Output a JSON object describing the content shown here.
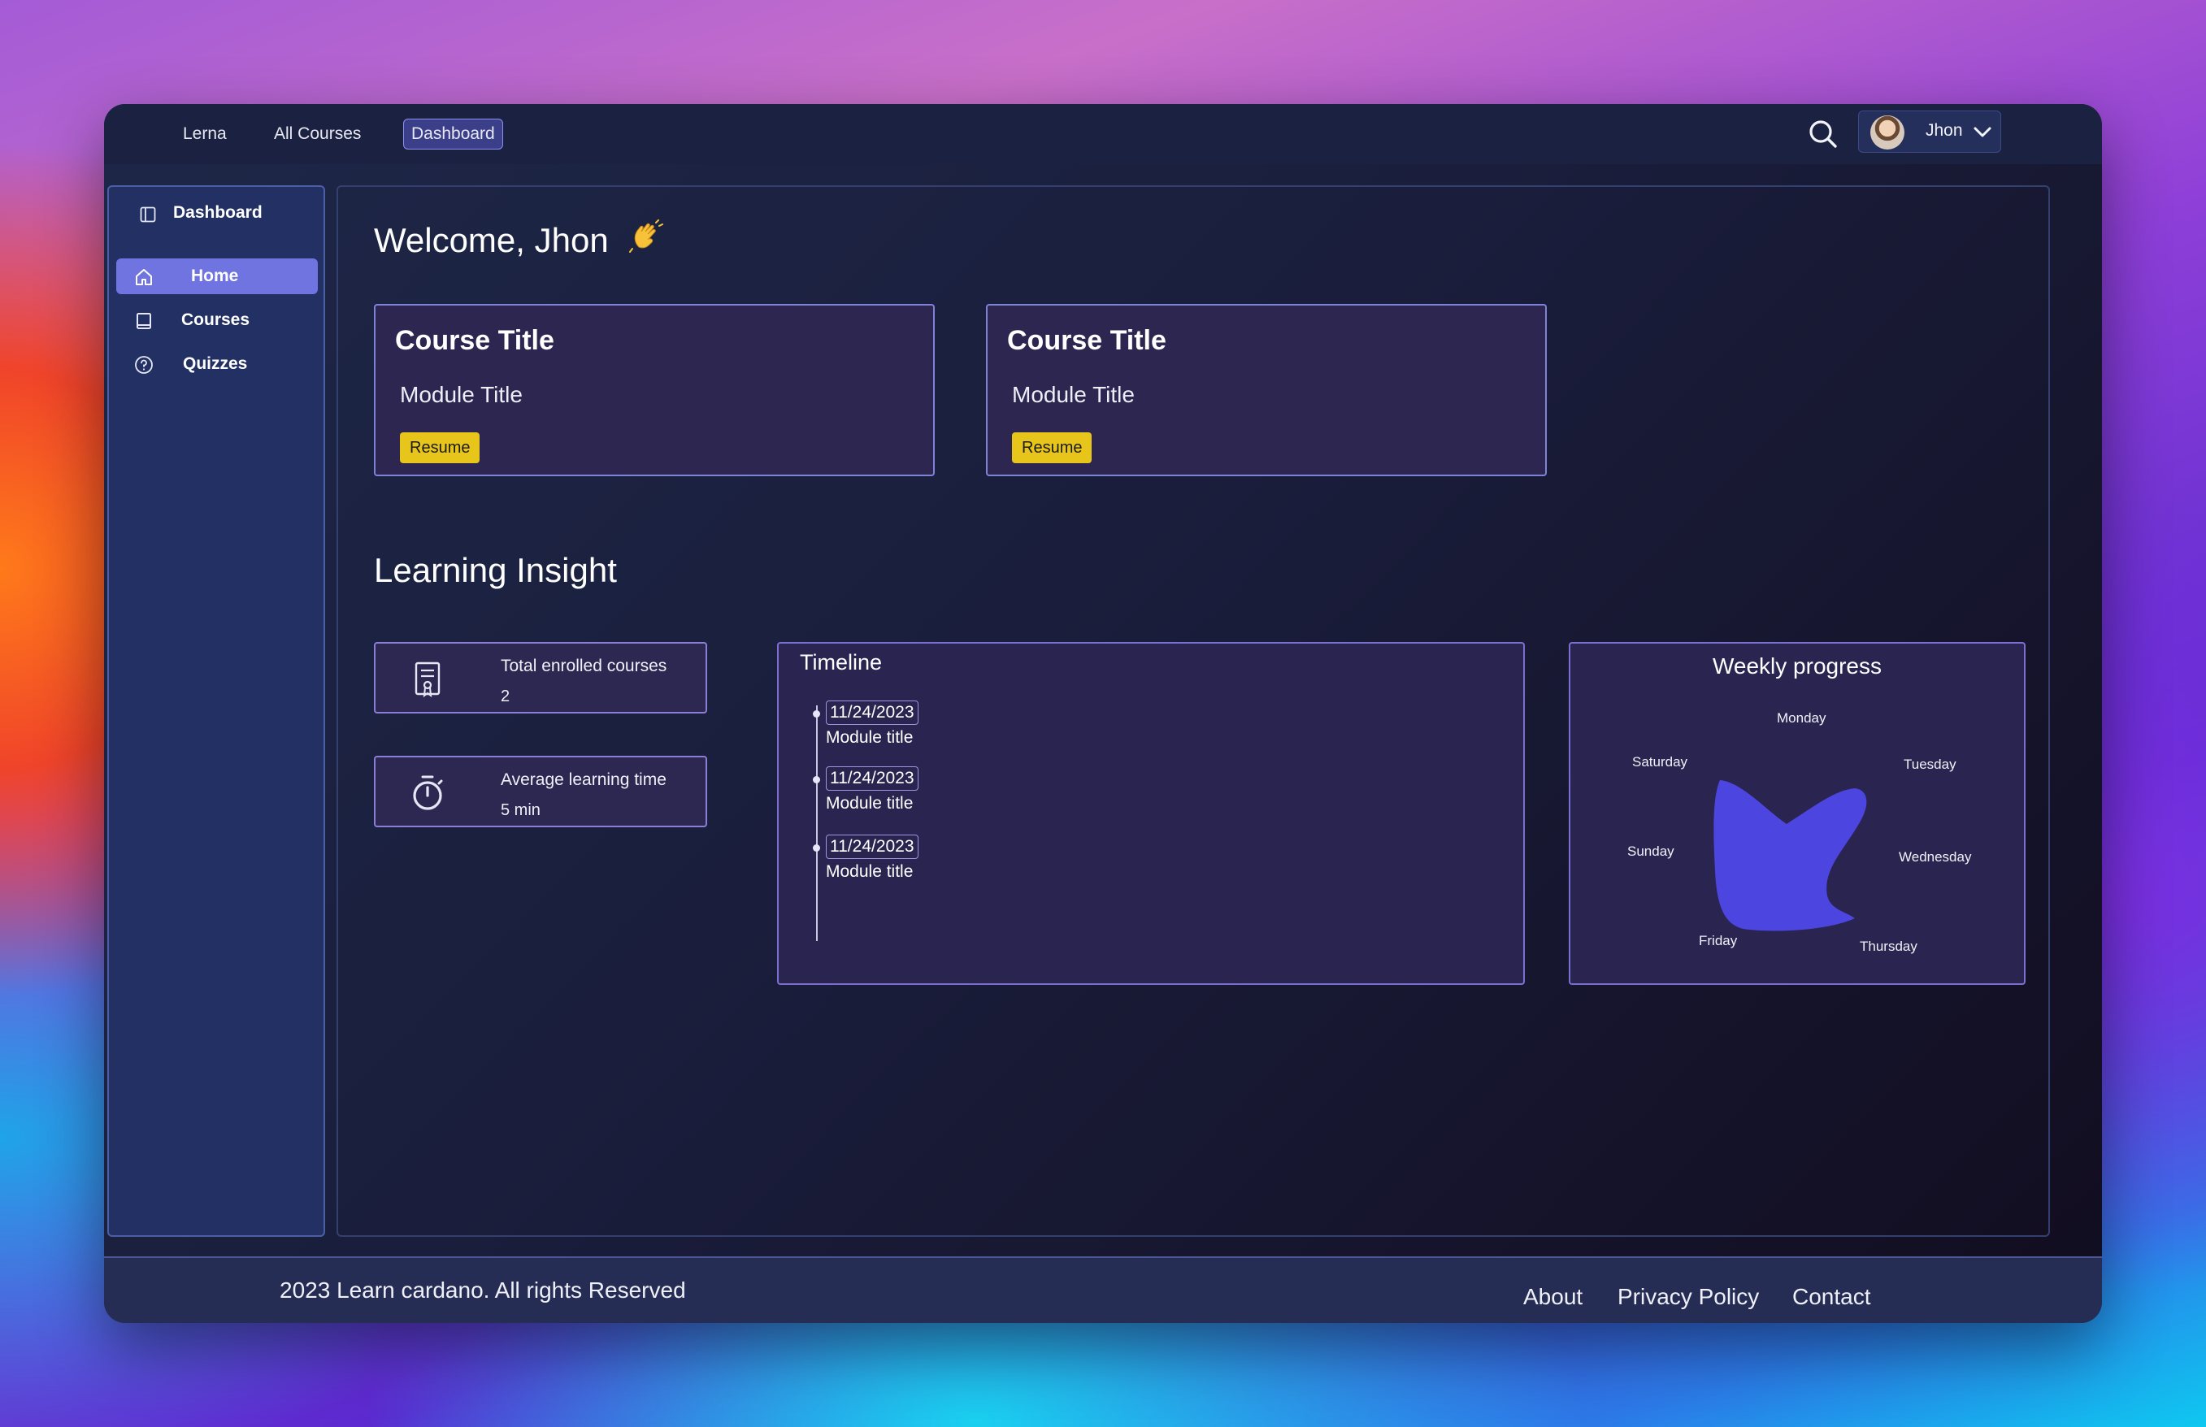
{
  "nav": {
    "brand": "Lerna",
    "all_courses": "All Courses",
    "dashboard": "Dashboard",
    "user_name": "Jhon",
    "search_icon": "search-icon",
    "chevron_icon": "chevron-down-icon"
  },
  "sidebar": {
    "title": "Dashboard",
    "items": [
      {
        "label": "Home",
        "icon": "home-icon",
        "active": true
      },
      {
        "label": "Courses",
        "icon": "book-icon",
        "active": false
      },
      {
        "label": "Quizzes",
        "icon": "question-circle-icon",
        "active": false
      }
    ]
  },
  "main": {
    "welcome": "Welcome, Jhon",
    "courses": [
      {
        "title": "Course Title",
        "module": "Module Title",
        "action": "Resume"
      },
      {
        "title": "Course Title",
        "module": "Module Title",
        "action": "Resume"
      }
    ],
    "insight_title": "Learning Insight",
    "stats": [
      {
        "label": "Total enrolled courses",
        "value": "2",
        "icon": "certificate-icon"
      },
      {
        "label": "Average learning time",
        "value": "5 min",
        "icon": "stopwatch-icon"
      }
    ],
    "timeline": {
      "title": "Timeline",
      "items": [
        {
          "date": "11/24/2023",
          "module": "Module title"
        },
        {
          "date": "11/24/2023",
          "module": "Module title"
        },
        {
          "date": "11/24/2023",
          "module": "Module title"
        }
      ]
    },
    "weekly": {
      "title": "Weekly progress",
      "days": [
        "Monday",
        "Tuesday",
        "Wednesday",
        "Thursday",
        "Friday",
        "Sunday",
        "Saturday"
      ]
    }
  },
  "footer": {
    "copyright": "2023 Learn cardano. All rights Reserved",
    "links": [
      "About",
      "Privacy Policy",
      "Contact"
    ]
  },
  "colors": {
    "accent": "#6f74e0",
    "resume": "#e8c51a",
    "blob": "#4d45e0"
  }
}
